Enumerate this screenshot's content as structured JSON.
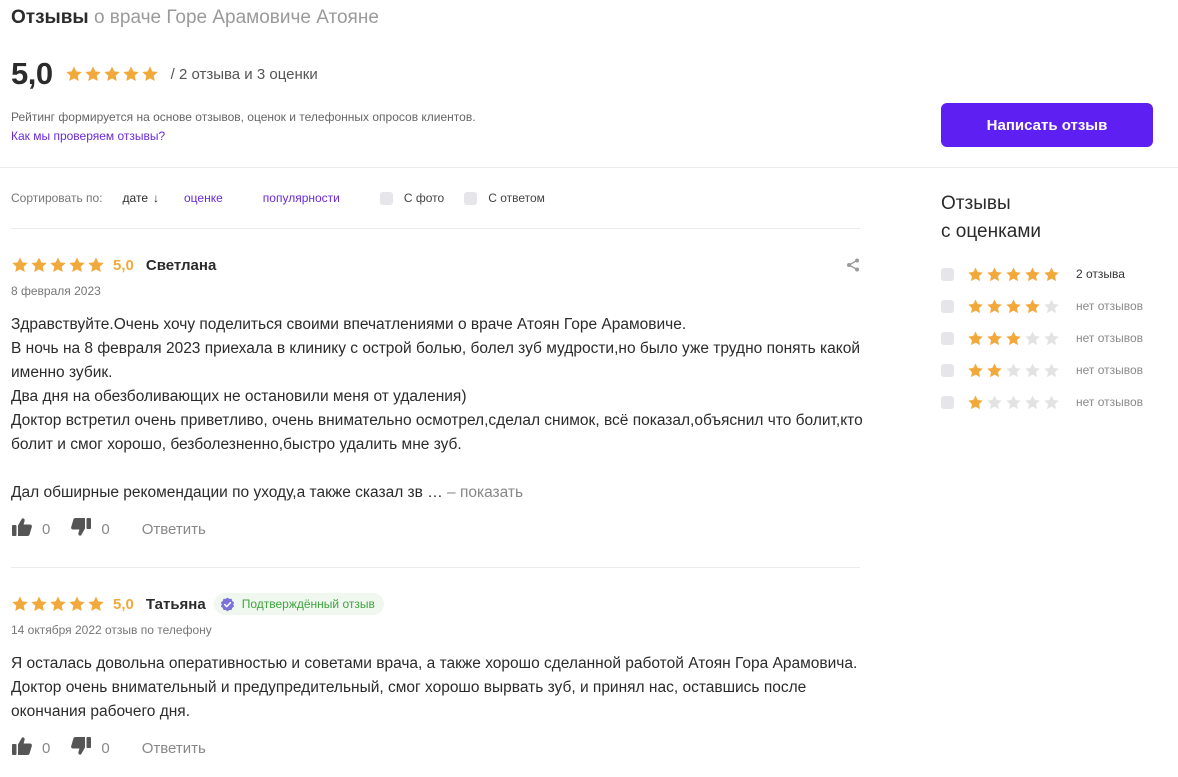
{
  "header": {
    "title_bold": "Отзывы",
    "title_rest": "о враче Горе Арамовиче Атояне",
    "rating": "5,0",
    "rating_stars": 5,
    "counts": "/  2 отзыва и 3 оценки",
    "hint": "Рейтинг формируется на основе отзывов, оценок и телефонных опросов клиентов.",
    "check_link": "Как мы проверяем отзывы?",
    "write_button": "Написать отзыв"
  },
  "colors": {
    "star_filled": "#f2a93b",
    "star_empty": "#e3e3e3",
    "accent": "#5e1ff2",
    "link": "#6b2bd9",
    "verified": "#3fa43f"
  },
  "sort": {
    "label": "Сортировать по:",
    "active": "дате",
    "active_icon": "arrow-down-icon",
    "option_rating": "оценке",
    "option_popularity": "популярности",
    "filter_photo": "С фото",
    "filter_reply": "С ответом"
  },
  "reviews": [
    {
      "stars": 5,
      "score": "5,0",
      "author": "Светлана",
      "date": "8 февраля 2023",
      "text": "Здравствуйте.Очень хочу поделиться своими впечатлениями о враче Атоян Горе Арамовиче.\nВ ночь на 8 февраля 2023 приехала в клинику с острой болью, болел зуб мудрости,но было уже трудно понять какой именно зубик.\nДва дня на обезболивающих не остановили меня от удаления)\nДоктор встретил очень приветливо, очень внимательно осмотрел,сделал снимок, всё показал,объяснил что болит,кто болит и смог хорошо, безболезненно,быстро удалить мне зуб.\n\nДал обширные рекомендации по уходу,а также сказал зв …",
      "more": "– показать",
      "likes": "0",
      "dislikes": "0",
      "reply": "Ответить"
    },
    {
      "stars": 5,
      "score": "5,0",
      "author": "Татьяна",
      "badge": "Подтверждённый отзыв",
      "date": "14 октября 2022 отзыв по телефону",
      "text": "Я осталась довольна оперативностью и советами врача, а также хорошо сделанной работой Атоян Гора Арамовича. Доктор очень внимательный и предупредительный, смог хорошо вырвать зуб, и принял нас, оставшись после окончания рабочего дня.",
      "likes": "0",
      "dislikes": "0",
      "reply": "Ответить"
    }
  ],
  "sidebar": {
    "title_line1": "Отзывы",
    "title_line2": "с оценками",
    "rows": [
      {
        "stars": 5,
        "count": "2 отзыва",
        "has": true
      },
      {
        "stars": 4,
        "count": "нет отзывов",
        "has": false
      },
      {
        "stars": 3,
        "count": "нет отзывов",
        "has": false
      },
      {
        "stars": 2,
        "count": "нет отзывов",
        "has": false
      },
      {
        "stars": 1,
        "count": "нет отзывов",
        "has": false
      }
    ]
  }
}
